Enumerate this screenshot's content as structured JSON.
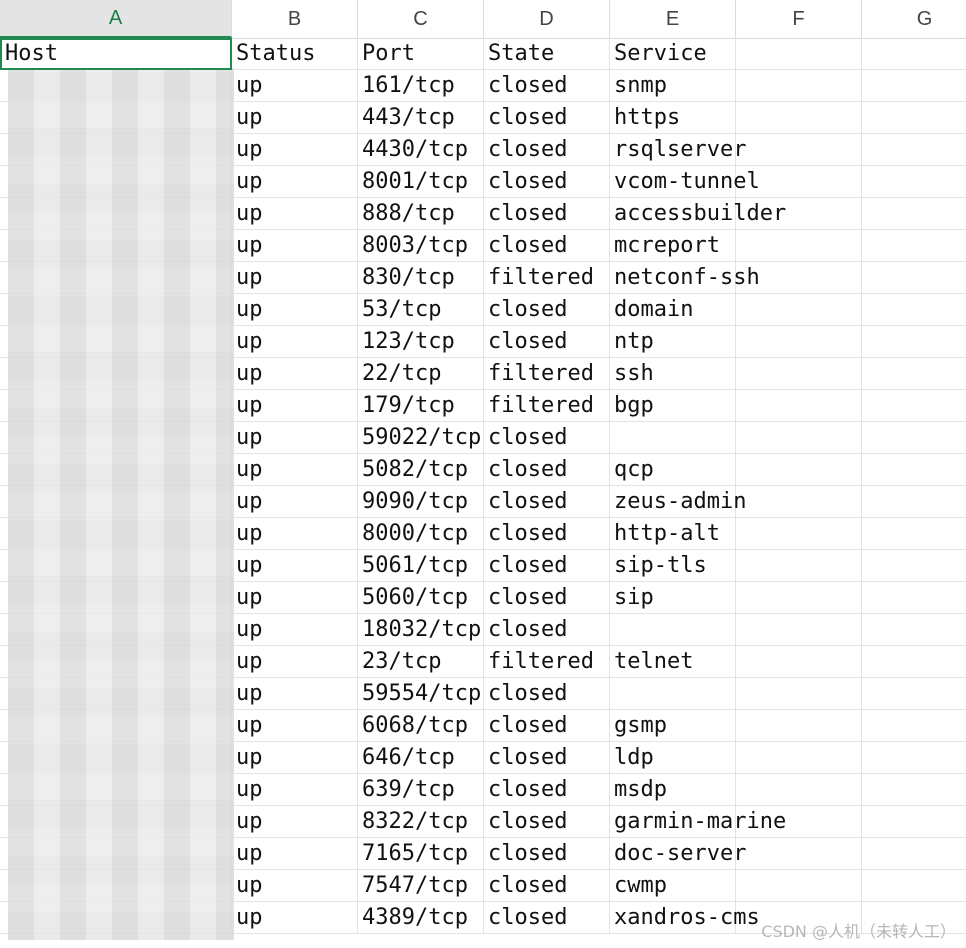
{
  "columns": [
    "A",
    "B",
    "C",
    "D",
    "E",
    "F",
    "G"
  ],
  "headers": {
    "host": "Host",
    "status": "Status",
    "port": "Port",
    "state": "State",
    "service": "Service"
  },
  "rows": [
    {
      "status": "up",
      "port": "161/tcp",
      "state": "closed",
      "service": "snmp"
    },
    {
      "status": "up",
      "port": "443/tcp",
      "state": "closed",
      "service": "https"
    },
    {
      "status": "up",
      "port": "4430/tcp",
      "state": "closed",
      "service": "rsqlserver"
    },
    {
      "status": "up",
      "port": "8001/tcp",
      "state": "closed",
      "service": "vcom-tunnel"
    },
    {
      "status": "up",
      "port": "888/tcp",
      "state": "closed",
      "service": "accessbuilder"
    },
    {
      "status": "up",
      "port": "8003/tcp",
      "state": "closed",
      "service": "mcreport"
    },
    {
      "status": "up",
      "port": "830/tcp",
      "state": "filtered",
      "service": "netconf-ssh"
    },
    {
      "status": "up",
      "port": "53/tcp",
      "state": "closed",
      "service": "domain"
    },
    {
      "status": "up",
      "port": "123/tcp",
      "state": "closed",
      "service": "ntp"
    },
    {
      "status": "up",
      "port": "22/tcp",
      "state": "filtered",
      "service": "ssh"
    },
    {
      "status": "up",
      "port": "179/tcp",
      "state": "filtered",
      "service": "bgp"
    },
    {
      "status": "up",
      "port": "59022/tcp",
      "state": "closed",
      "service": ""
    },
    {
      "status": "up",
      "port": "5082/tcp",
      "state": "closed",
      "service": "qcp"
    },
    {
      "status": "up",
      "port": "9090/tcp",
      "state": "closed",
      "service": "zeus-admin"
    },
    {
      "status": "up",
      "port": "8000/tcp",
      "state": "closed",
      "service": "http-alt"
    },
    {
      "status": "up",
      "port": "5061/tcp",
      "state": "closed",
      "service": "sip-tls"
    },
    {
      "status": "up",
      "port": "5060/tcp",
      "state": "closed",
      "service": "sip"
    },
    {
      "status": "up",
      "port": "18032/tcp",
      "state": "closed",
      "service": ""
    },
    {
      "status": "up",
      "port": "23/tcp",
      "state": "filtered",
      "service": "telnet"
    },
    {
      "status": "up",
      "port": "59554/tcp",
      "state": "closed",
      "service": ""
    },
    {
      "status": "up",
      "port": "6068/tcp",
      "state": "closed",
      "service": "gsmp"
    },
    {
      "status": "up",
      "port": "646/tcp",
      "state": "closed",
      "service": "ldp"
    },
    {
      "status": "up",
      "port": "639/tcp",
      "state": "closed",
      "service": "msdp"
    },
    {
      "status": "up",
      "port": "8322/tcp",
      "state": "closed",
      "service": "garmin-marine"
    },
    {
      "status": "up",
      "port": "7165/tcp",
      "state": "closed",
      "service": "doc-server"
    },
    {
      "status": "up",
      "port": "7547/tcp",
      "state": "closed",
      "service": "cwmp"
    },
    {
      "status": "up",
      "port": "4389/tcp",
      "state": "closed",
      "service": "xandros-cms"
    }
  ],
  "watermark": "CSDN @人机（未转人工）",
  "colors": {
    "selection": "#1f8a52",
    "header_selected_bg": "#e4e4e4",
    "gridline": "#e3e3e3"
  }
}
